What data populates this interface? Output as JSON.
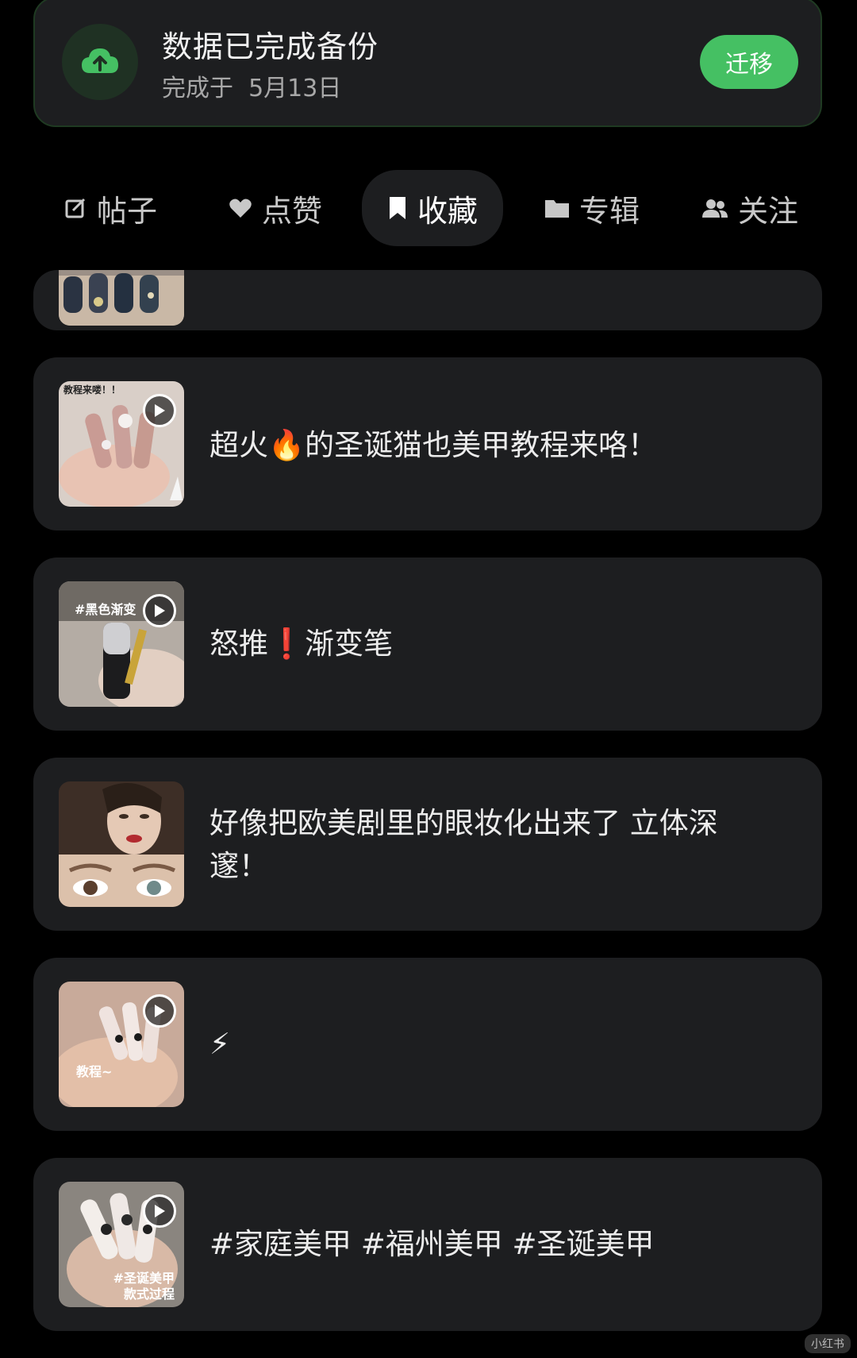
{
  "backup": {
    "title": "数据已完成备份",
    "completed_prefix": "完成于",
    "completed_date": "5月13日",
    "migrate_label": "迁移",
    "icon": "cloud-upload-icon",
    "accent": "#45c063"
  },
  "tabs": [
    {
      "label": "帖子",
      "icon": "edit-icon",
      "active": false
    },
    {
      "label": "点赞",
      "icon": "heart-icon",
      "active": false
    },
    {
      "label": "收藏",
      "icon": "bookmark-icon",
      "active": true
    },
    {
      "label": "专辑",
      "icon": "folder-icon",
      "active": false
    },
    {
      "label": "关注",
      "icon": "people-icon",
      "active": false
    }
  ],
  "items": [
    {
      "text": "",
      "thumb_caption": "",
      "has_video": false
    },
    {
      "text": "超火🔥的圣诞猫也美甲教程来咯！",
      "thumb_caption": "教程来喽！！",
      "has_video": true
    },
    {
      "text": "怒推❗渐变笔",
      "thumb_caption": "#黑色渐变",
      "has_video": true
    },
    {
      "text": "好像把欧美剧里的眼妆化出来了 立体深邃！",
      "thumb_caption": "",
      "has_video": false
    },
    {
      "text": "⚡",
      "thumb_caption": "教程~",
      "has_video": true
    },
    {
      "text": "#家庭美甲 #福州美甲 #圣诞美甲",
      "thumb_caption": "#圣诞美甲 款式过程",
      "has_video": true
    }
  ],
  "watermark": "小红书"
}
